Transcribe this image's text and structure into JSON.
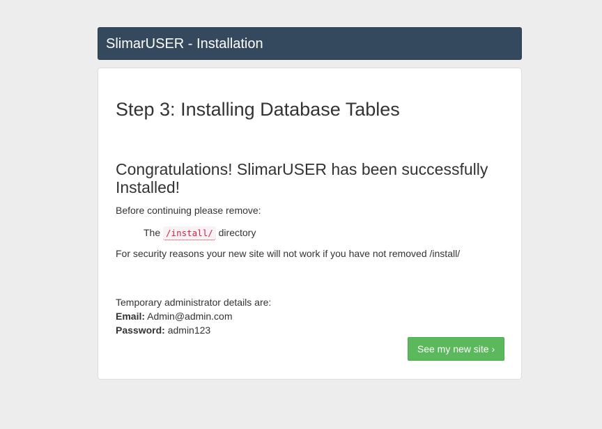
{
  "header": {
    "title": "SlimarUSER - Installation"
  },
  "main": {
    "step_title": "Step 3: Installing Database Tables",
    "congrats": "Congratulations! SlimarUSER has been successfully Installed!",
    "before_continuing": "Before continuing please remove:",
    "remove_prefix": "The",
    "remove_path": "/install/",
    "remove_suffix": "directory",
    "security_note": "For security reasons your new site will not work if you have not removed /install/",
    "admin_intro": "Temporary administrator details are:",
    "email_label": "Email:",
    "email_value": "Admin@admin.com",
    "password_label": "Password:",
    "password_value": "admin123",
    "see_site_button": "See my new site ›"
  },
  "colors": {
    "background": "#ededed",
    "header_bg": "#34495e",
    "button_bg": "#5cb85c",
    "code_text": "#c7254e"
  }
}
